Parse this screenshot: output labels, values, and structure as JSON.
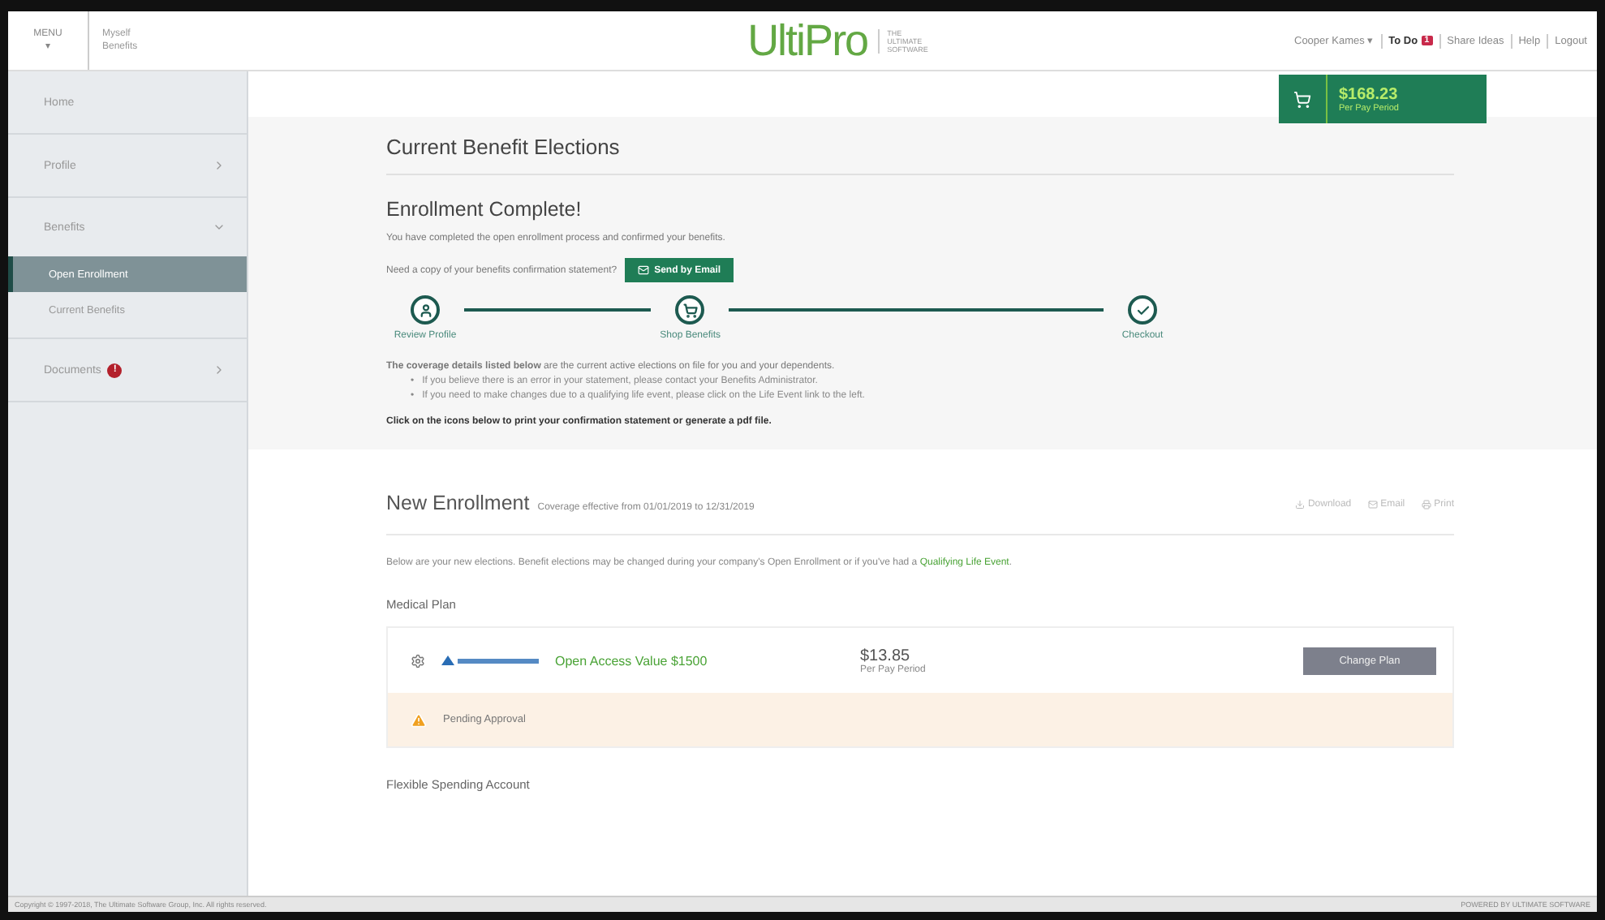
{
  "top_bar": {
    "menu_button": {
      "label": "MENU",
      "icon": "▾"
    },
    "breadcrumb": [
      "Myself",
      "Benefits"
    ],
    "logo": {
      "name": "UltiPro",
      "tagline": [
        "THE",
        "ULTIMATE",
        "SOFTWARE"
      ]
    },
    "user_menu": "Cooper Kames ▾",
    "todo": {
      "label": "To Do",
      "count": "1"
    },
    "links": [
      "Share Ideas",
      "Help",
      "Logout"
    ]
  },
  "cart": {
    "amount": "$168.23",
    "period": "Per Pay Period"
  },
  "sidebar": {
    "items": [
      {
        "label": "Home"
      },
      {
        "label": "Profile",
        "expanded": false
      },
      {
        "label": "Benefits",
        "expanded": true,
        "children": [
          {
            "label": "Open Enrollment",
            "selected": true
          },
          {
            "label": "Current Benefits",
            "selected": false
          }
        ]
      },
      {
        "label": "Documents",
        "expanded": false,
        "badge": "!"
      }
    ]
  },
  "page_title": "Current Benefit Elections",
  "confirmation": {
    "heading": "Enrollment Complete!",
    "message": "You have completed the open enrollment process and confirmed your benefits.",
    "copy_prompt": "Need a copy of your benefits confirmation statement?",
    "send_button": "Send by Email"
  },
  "steps": [
    {
      "label": "Review Profile"
    },
    {
      "label": "Shop Benefits"
    },
    {
      "label": "Checkout"
    }
  ],
  "coverage_note": {
    "intro": "**The coverage details listed below** are the current active elections on file for you and your dependents.",
    "marker": "•",
    "bullets": [
      "If you believe there is an error in your statement, please contact your Benefits Administrator.",
      "If you need to make changes due to a qualifying life event, please click on the Life Event link to the left."
    ],
    "instruction": "Click on the icons below to print your confirmation statement or generate a pdf file."
  },
  "enrollment": {
    "title": "New Enrollment",
    "subtitle": "Coverage effective from 01/01/2019 to 12/31/2019",
    "actions": [
      "Download",
      "Email",
      "Print"
    ],
    "intro": "Below are your new elections. Benefit elections may be changed during your company's Open Enrollment or if you've had a",
    "intro_link": "Qualifying Life Event",
    "intro_end": ".",
    "sections": [
      {
        "title": "Medical Plan",
        "plans": [
          {
            "name": "Open Access Value $1500",
            "price": "$13.85",
            "period": "Per Pay Period",
            "button": "Change Plan",
            "status": "Pending Approval"
          }
        ]
      },
      {
        "title": "Flexible Spending Account"
      }
    ]
  },
  "footer": {
    "copyright": "Copyright © 1997-2018, The Ultimate Software Group, Inc. All rights reserved.",
    "powered": "POWERED BY ULTIMATE SOFTWARE"
  }
}
